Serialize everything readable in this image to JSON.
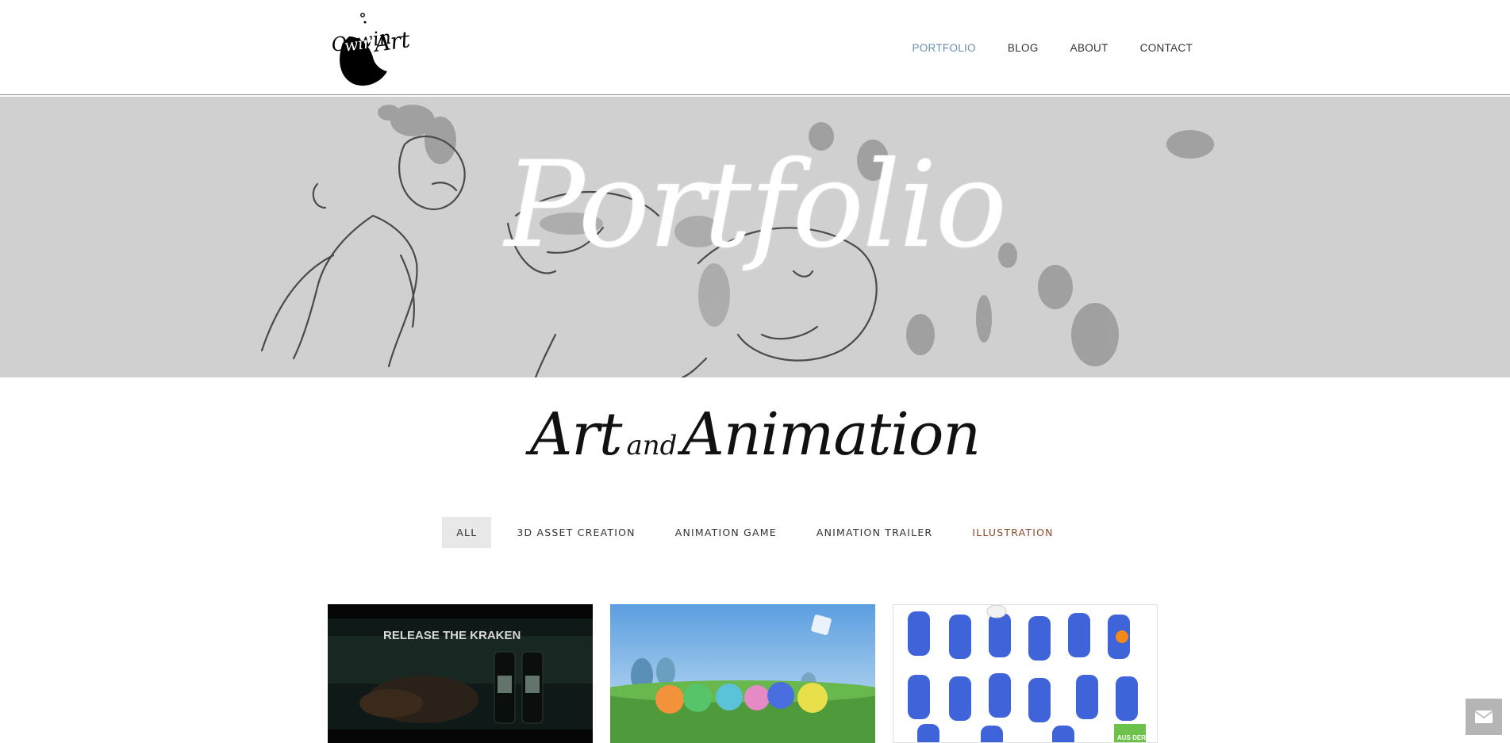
{
  "header": {
    "logo_alt": "Oswin Art",
    "nav": [
      {
        "label": "PORTFOLIO",
        "active": true
      },
      {
        "label": "BLOG",
        "active": false
      },
      {
        "label": "ABOUT",
        "active": false
      },
      {
        "label": "CONTACT",
        "active": false
      }
    ]
  },
  "hero": {
    "title": "Portfolio"
  },
  "section": {
    "title_part1": "Art",
    "title_part2": "and",
    "title_part3": "Animation"
  },
  "filters": [
    {
      "label": "ALL",
      "active": true
    },
    {
      "label": "3D ASSET CREATION",
      "active": false
    },
    {
      "label": "ANIMATION GAME",
      "active": false
    },
    {
      "label": "ANIMATION TRAILER",
      "active": false
    },
    {
      "label": "ILLUSTRATION",
      "active": false
    }
  ],
  "portfolio": {
    "tiles": [
      {
        "caption": "RELEASE THE KRAKEN"
      },
      {
        "caption": ""
      },
      {
        "caption": "AUS DER"
      }
    ]
  },
  "colors": {
    "nav_active": "#6a8eaf",
    "hero_bg": "#d0d0d0",
    "filter_active_bg": "#e8e8e8",
    "illustration_accent": "#8a4a2a"
  },
  "icons": {
    "contact_float": "envelope-icon"
  }
}
